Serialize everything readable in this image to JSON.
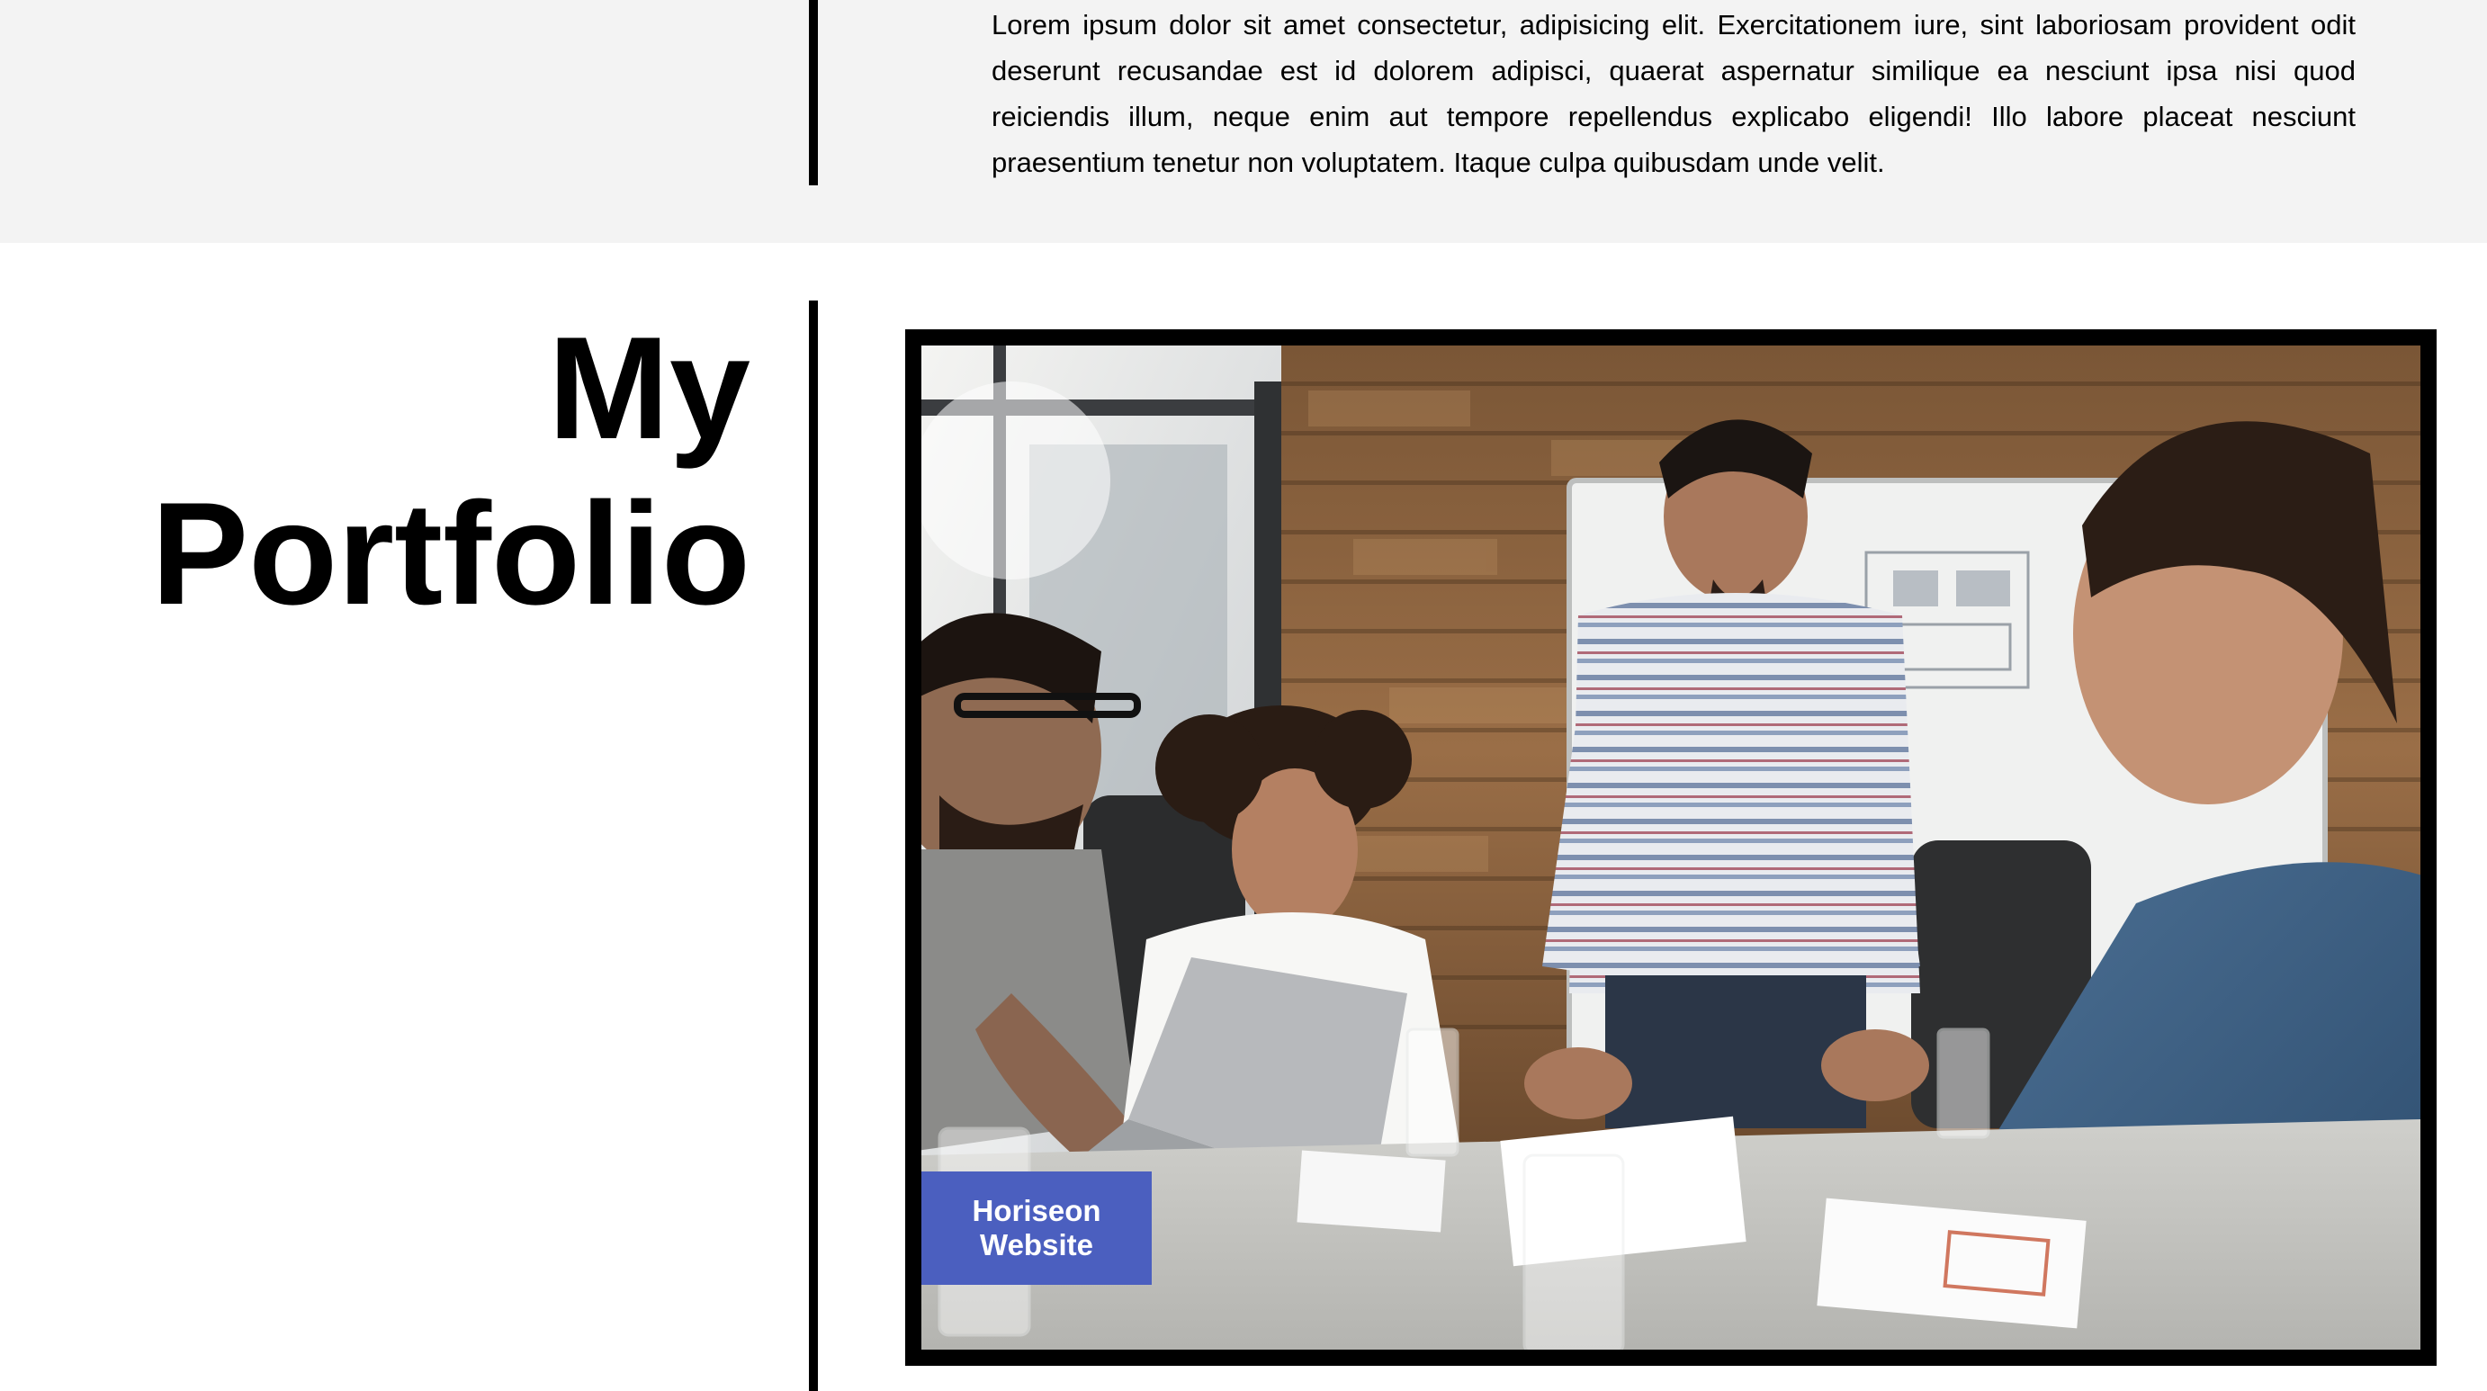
{
  "about": {
    "text": "Lorem ipsum dolor sit amet consectetur, adipisicing elit. Exercitationem iure, sint laboriosam provident odit deserunt recusandae est id dolorem adipisci, quaerat aspernatur similique ea nesciunt ipsa nisi quod reiciendis illum, neque enim aut tempore repellendus explicabo eligendi! Illo labore placeat nesciunt praesentium tenetur non voluptatem. Itaque culpa quibusdam unde velit."
  },
  "portfolio": {
    "title_line1": "My",
    "title_line2": "Portfolio",
    "projects": [
      {
        "label": "Horiseon Website",
        "image": "team-meeting-photo"
      }
    ]
  },
  "colors": {
    "about_background": "#f3f3f3",
    "divider": "#000000",
    "card_border": "#000000",
    "label_background": "#4b5fbf",
    "label_text": "#ffffff"
  }
}
